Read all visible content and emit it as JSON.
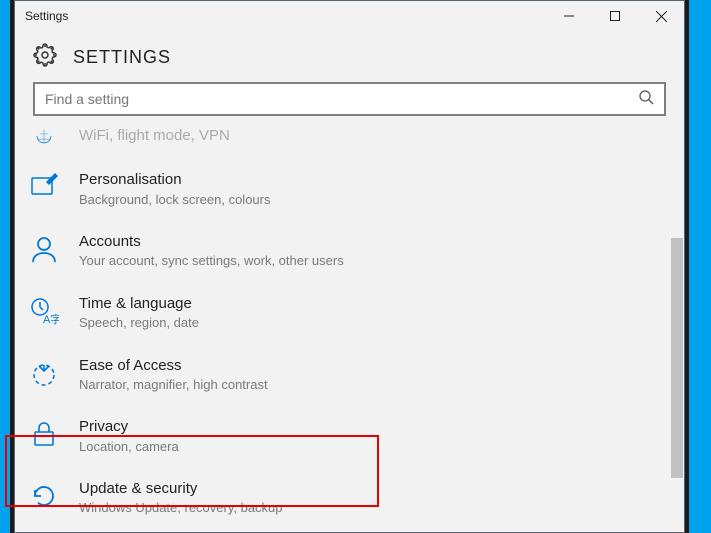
{
  "window": {
    "title": "Settings"
  },
  "header": {
    "page_title": "SETTINGS"
  },
  "search": {
    "placeholder": "Find a setting"
  },
  "categories": [
    {
      "icon": "globe-icon",
      "title": "WiFi, flight mode, VPN",
      "subtitle": "",
      "partial": true
    },
    {
      "icon": "personalisation-icon",
      "title": "Personalisation",
      "subtitle": "Background, lock screen, colours"
    },
    {
      "icon": "accounts-icon",
      "title": "Accounts",
      "subtitle": "Your account, sync settings, work, other users"
    },
    {
      "icon": "time-language-icon",
      "title": "Time & language",
      "subtitle": "Speech, region, date"
    },
    {
      "icon": "ease-of-access-icon",
      "title": "Ease of Access",
      "subtitle": "Narrator, magnifier, high contrast"
    },
    {
      "icon": "privacy-icon",
      "title": "Privacy",
      "subtitle": "Location, camera"
    },
    {
      "icon": "update-security-icon",
      "title": "Update & security",
      "subtitle": "Windows Update, recovery, backup"
    }
  ]
}
